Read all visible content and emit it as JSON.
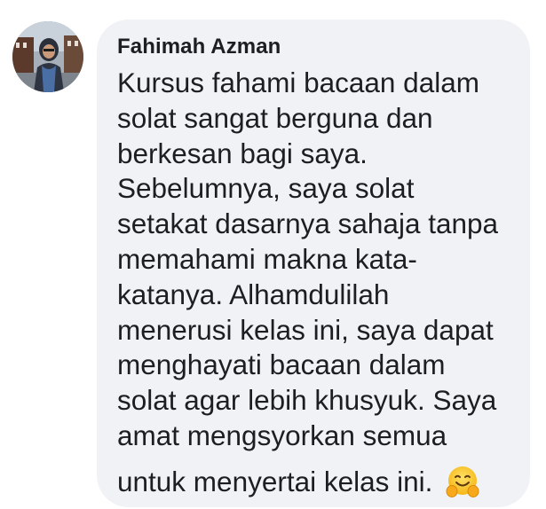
{
  "comment": {
    "author": "Fahimah Azman",
    "lines": [
      "Kursus fahami bacaan dalam",
      "solat sangat berguna dan",
      "berkesan bagi saya.",
      "Sebelumnya, saya solat",
      "setakat dasarnya sahaja tanpa",
      "memahami makna kata-",
      "katanya. Alhamdulilah",
      "menerusi kelas ini, saya dapat",
      "menghayati bacaan dalam",
      "solat agar lebih khusyuk. Saya",
      "amat mengsyorkan semua",
      "untuk menyertai kelas ini."
    ],
    "emoji": "hugging-face-emoji"
  },
  "colors": {
    "bubble_background": "#f1f2f6",
    "text": "#1c1e21"
  }
}
